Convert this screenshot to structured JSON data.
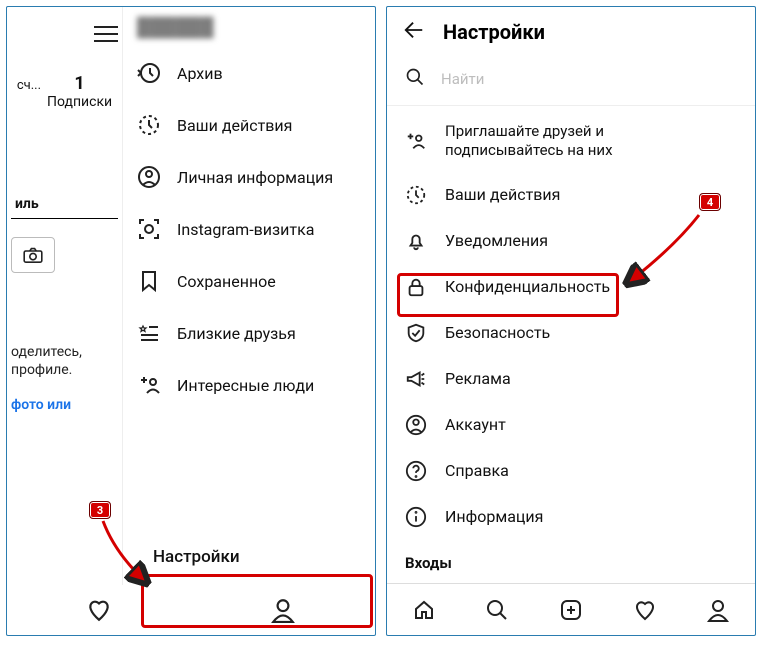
{
  "left": {
    "blurred_user": "██████",
    "count": "1",
    "count_label": "Подписки",
    "count_prefix": "сч...",
    "tab_fragment": "иль",
    "share_line1": "оделитесь,",
    "share_line2": " профиле.",
    "photo_link": "фото или",
    "menu": [
      {
        "key": "archive",
        "label": "Архив"
      },
      {
        "key": "actions",
        "label": "Ваши действия"
      },
      {
        "key": "personal",
        "label": "Личная информация"
      },
      {
        "key": "nametag",
        "label": "Instagram-визитка"
      },
      {
        "key": "saved",
        "label": "Сохраненное"
      },
      {
        "key": "close",
        "label": "Близкие друзья"
      },
      {
        "key": "interesting",
        "label": "Интересные люди"
      }
    ],
    "settings_label": "Настройки",
    "badge3": "3"
  },
  "right": {
    "title": "Настройки",
    "search_placeholder": "Найти",
    "items": [
      {
        "key": "invite",
        "label": "Приглашайте друзей и",
        "label2": "подписывайтесь на них"
      },
      {
        "key": "actions",
        "label": "Ваши действия"
      },
      {
        "key": "notify",
        "label": "Уведомления"
      },
      {
        "key": "privacy",
        "label": "Конфиденциальность"
      },
      {
        "key": "security",
        "label": "Безопасность"
      },
      {
        "key": "ads",
        "label": "Реклама"
      },
      {
        "key": "account",
        "label": "Аккаунт"
      },
      {
        "key": "help",
        "label": "Справка"
      },
      {
        "key": "info",
        "label": "Информация"
      }
    ],
    "section": "Входы",
    "badge4": "4"
  }
}
